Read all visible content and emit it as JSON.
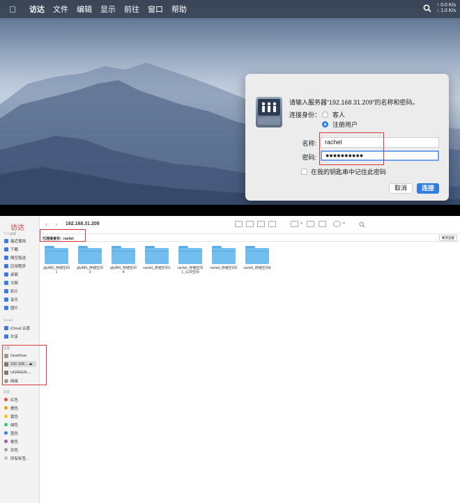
{
  "menubar": {
    "app_name": "访达",
    "items": [
      "文件",
      "编辑",
      "显示",
      "前往",
      "窗口",
      "帮助"
    ],
    "net_up": "0.0 K/s",
    "net_down": "1.0 K/s"
  },
  "login_dialog": {
    "prompt": "请输入服务器“192.168.31.209”的名称和密码。",
    "connect_as_label": "连接身份：",
    "options": [
      "客人",
      "注册用户"
    ],
    "selected_option": "注册用户",
    "name_label": "名称:",
    "name_value": "rachel",
    "password_label": "密码:",
    "password_value": "●●●●●●●●●●",
    "remember_label": "在我的钥匙串中记住此密码",
    "cancel_label": "取消",
    "connect_label": "连接"
  },
  "finder": {
    "app_title": "访达",
    "window_title": "192.168.31.209",
    "connected_as": "已连接身份：rachel",
    "disconnect_label": "断开连接",
    "sidebar": {
      "favorites_header": "个人收藏",
      "favorites": [
        "最近使用",
        "下载",
        "隔空投送",
        "应用程序",
        "桌面",
        "文稿",
        "影片",
        "音乐",
        "图片"
      ],
      "icloud_header": "iCloud",
      "icloud": [
        "iCloud 云盘",
        "共享"
      ],
      "locations_header": "位置",
      "locations": [
        "OneDrive",
        "192.168...",
        "UGREEN-...",
        "网络"
      ],
      "tags_header": "标签",
      "tags": [
        {
          "label": "红色",
          "color": "#e74c3c"
        },
        {
          "label": "橙色",
          "color": "#f39c12"
        },
        {
          "label": "黄色",
          "color": "#f1c40f"
        },
        {
          "label": "绿色",
          "color": "#2ecc71"
        },
        {
          "label": "蓝色",
          "color": "#3b7be0"
        },
        {
          "label": "紫色",
          "color": "#9b59b6"
        },
        {
          "label": "灰色",
          "color": "#95a5a6"
        },
        {
          "label": "所有标签...",
          "color": "#bdbdbd"
        }
      ]
    },
    "folders": [
      {
        "line1": "gty489_存储空间",
        "line2": "1"
      },
      {
        "line1": "gty489_存储空间",
        "line2": "2"
      },
      {
        "line1": "gty489_存储空间",
        "line2": "4"
      },
      {
        "line1": "rachel_存储空间1",
        "line2": ""
      },
      {
        "line1": "rachel_存储空间",
        "line2": "1_公共空间"
      },
      {
        "line1": "rachel_存储空间2",
        "line2": ""
      },
      {
        "line1": "rachel_存储空间4",
        "line2": ""
      }
    ]
  }
}
